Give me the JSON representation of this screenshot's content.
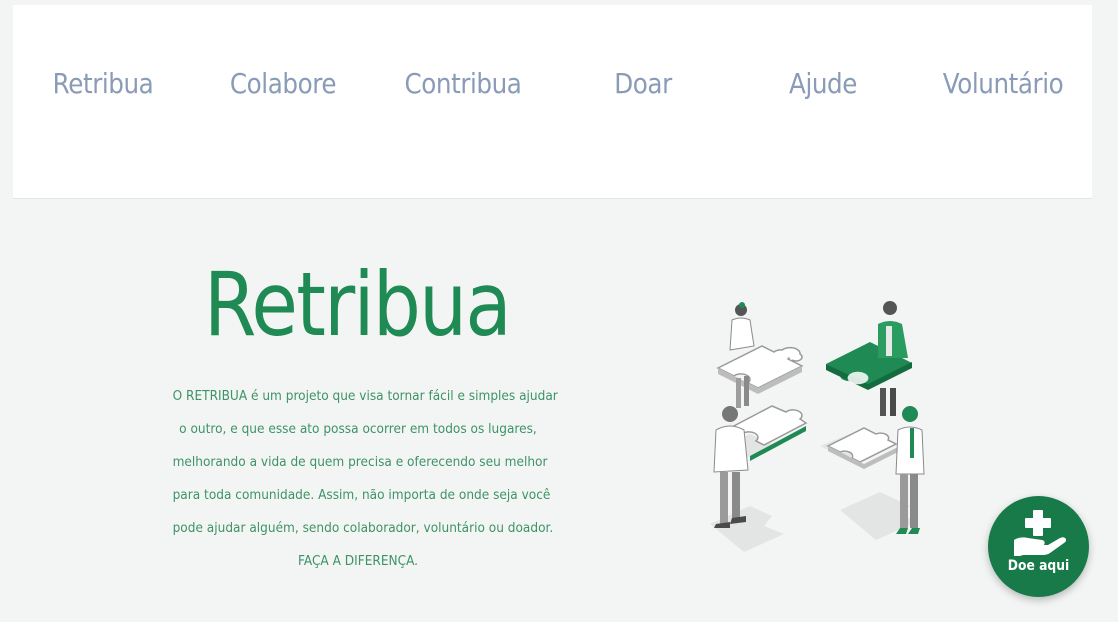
{
  "colors": {
    "nav_text": "#8a9bb8",
    "brand_green": "#1f8a53",
    "text_green": "#3d9365",
    "button_green": "#177a48",
    "background": "#f3f5f4"
  },
  "nav": {
    "items": [
      {
        "label": "Retribua"
      },
      {
        "label": "Colabore"
      },
      {
        "label": "Contribua"
      },
      {
        "label": "Doar"
      },
      {
        "label": "Ajude"
      },
      {
        "label": "Voluntário"
      }
    ]
  },
  "hero": {
    "title": "Retribua",
    "description_lines": [
      "O RETRIBUA é um projeto que visa tornar fácil e simples ajudar",
      "o outro, e que esse ato possa ocorrer em todos os lugares,",
      "melhorando a vida de quem precisa e oferecendo seu melhor",
      "para toda comunidade. Assim, não importa de onde seja você",
      "pode ajudar alguém, sendo colaborador, voluntário ou doador.",
      "FAÇA A DIFERENÇA."
    ],
    "illustration_icon": "puzzle-team-illustration"
  },
  "donate_button": {
    "label": "Doe aqui",
    "icon": "hand-medical-cross-icon"
  }
}
